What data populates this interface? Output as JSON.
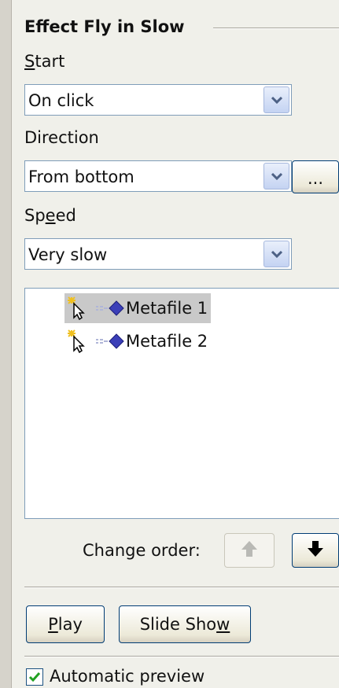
{
  "panel": {
    "heading": "Effect Fly in Slow",
    "start": {
      "label_mnemonic": "S",
      "label_rest": "tart",
      "value": "On click"
    },
    "direction": {
      "label": "Direction",
      "value": "From bottom",
      "options_button": "..."
    },
    "speed": {
      "label_pre": "Sp",
      "label_mnemonic": "e",
      "label_rest": "ed",
      "value": "Very slow"
    },
    "effects_list": [
      {
        "name": "Metafile 1",
        "selected": true
      },
      {
        "name": "Metafile 2",
        "selected": false
      }
    ],
    "change_order_label": "Change order:",
    "play_mnemonic": "P",
    "play_rest": "lay",
    "slideshow_pre": "Slide Sho",
    "slideshow_mnemonic": "w",
    "automatic_preview_label": "Automatic preview",
    "automatic_preview_checked": true
  },
  "icons": {
    "combo_arrow": "chevron-down-icon",
    "move_up": "arrow-up-icon",
    "move_down": "arrow-down-icon",
    "effect_trigger": "click-sparkle-pointer-icon",
    "effect_type": "fly-in-diamond-icon"
  }
}
